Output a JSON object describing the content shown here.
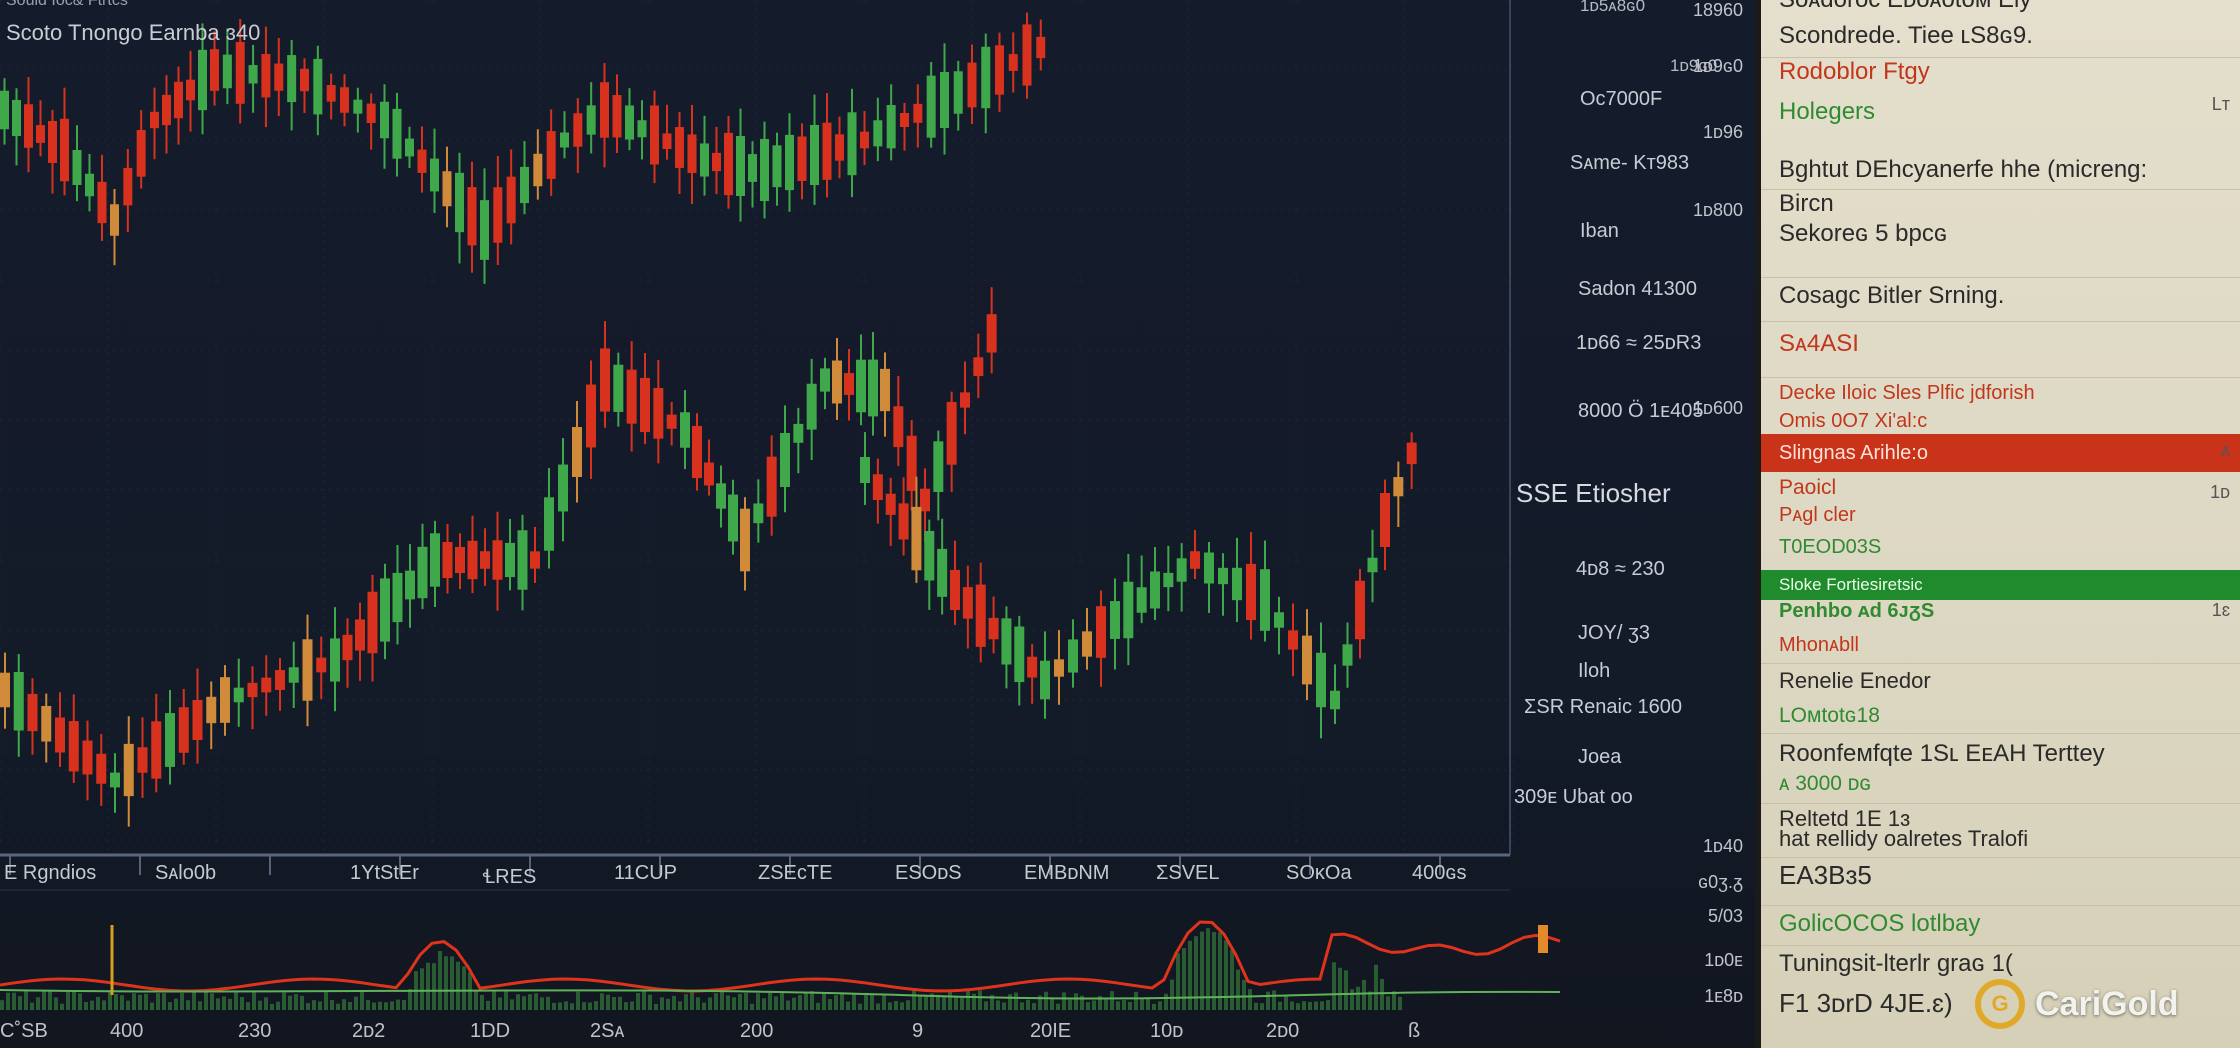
{
  "chart": {
    "top_label": "Sould Ioc& Ftrtcs",
    "title": "Scoto Tnongo Earnba ɜ40",
    "price_labels": [
      {
        "text": "1ᴅ5ᴀ8ɢ0",
        "size": "small"
      },
      {
        "text": "1ᴅ9ɢ0",
        "size": "small"
      },
      {
        "text": "Oc7000F",
        "size": "normal"
      },
      {
        "text": "Sᴀme- Kᴛ983",
        "size": "normal"
      },
      {
        "text": "Iban",
        "size": "normal"
      },
      {
        "text": "Sadon 41300",
        "size": "normal"
      },
      {
        "text": "1ᴅ66 ≈ 25ᴅR3",
        "size": "normal"
      },
      {
        "text": "8000 Ö 1ᴇ405",
        "size": "normal"
      },
      {
        "text": "SSE Etiosher",
        "size": "big"
      },
      {
        "text": "4ᴅ8 ≈ 230",
        "size": "normal"
      },
      {
        "text": "JOY/ ʒ3",
        "size": "normal"
      },
      {
        "text": "Iloh",
        "size": "normal"
      },
      {
        "text": "ƩSR Renaic 1600",
        "size": "normal"
      },
      {
        "text": "Joea",
        "size": "normal"
      },
      {
        "text": "309ᴇ Ubat oo",
        "size": "normal"
      }
    ],
    "right_prices": [
      "18960",
      "1ᴅ9ɢ0",
      "1ᴅ96",
      "1ᴅ800",
      "1ᴅ600",
      "1ᴅ40",
      "ɢ0ʒ.ᵹ",
      "5/03",
      "1ᴅ0ᴇ",
      "1ᴇ8ᴅ"
    ],
    "x_ticks": [
      "E Rgndios",
      "Sᴀlo0b",
      "1YtStEr",
      "ꞭRES",
      "11CUP",
      "ZSEᴄTE",
      "ESOᴅS",
      "EMBᴅNM",
      "ƩSVEL",
      "SOᴋOa",
      "400ɢs"
    ],
    "bottom_ticks": [
      "C˚SB",
      "400",
      "230",
      "2ᴅ2",
      "1DD",
      "2Sᴀ",
      "200",
      "9",
      "20IE",
      "10ᴅ",
      "2ᴅ0",
      "ß"
    ]
  },
  "sidebar": {
    "rows": [
      {
        "text": "Soᴀdoroc Eᴅoᴀotoᴍ Eiy",
        "style": "dark"
      },
      {
        "text": "Scondrede. Tiee ʟS8ɢ9.",
        "style": "dark"
      },
      {
        "text": "Rodoblor Ftgy",
        "style": "red"
      },
      {
        "text": "Holegers",
        "style": "green"
      },
      {
        "text": "Bghtut DEhcyanerfe hhe (micreng:",
        "style": "dark"
      },
      {
        "text": "Bircn",
        "style": "dark"
      },
      {
        "text": "Sekoreɢ 5 bpcɢ",
        "style": "dark"
      },
      {
        "text": "Cosagc Bitler Srning.",
        "style": "dark"
      },
      {
        "text": "Sᴀ4ASI",
        "style": "red"
      },
      {
        "text": "Decke Iloic Sles Plfic jdforish",
        "style": "red"
      },
      {
        "text": "Omis 0O7 Xiʹal:ᴄ",
        "style": "red"
      },
      {
        "text": "Slingnas Arihle:o",
        "style": "redbar"
      },
      {
        "text": "Paoicl",
        "style": "red"
      },
      {
        "text": "Pᴀgl cler",
        "style": "red"
      },
      {
        "text": "T0EOD03S",
        "style": "green"
      },
      {
        "text": "Sloke Fortiesiretsic",
        "style": "greenbar"
      },
      {
        "text": "Penhbo ᴀd 6ᴊᵹS",
        "style": "green"
      },
      {
        "text": "Mhonᴀbll",
        "style": "red"
      },
      {
        "text": "Renelie Enedor",
        "style": "dark"
      },
      {
        "text": "LOᴍtotɢ18",
        "style": "green"
      },
      {
        "text": "Roonfeᴍfqte 1Sʟ EᴇAH Terttey",
        "style": "dark"
      },
      {
        "text": "ᴀ 3000 ᴅɢ",
        "style": "green"
      },
      {
        "text": "Reltetd 1E 1ɜ",
        "style": "dark"
      },
      {
        "text": "hat ʀellidy oalretes Tralofi",
        "style": "dark"
      },
      {
        "text": "EA3Bɜ5",
        "style": "dark"
      },
      {
        "text": "GolicOCOS lotlbay",
        "style": "green"
      },
      {
        "text": "Tuningsit-lterlr graɢ 1(",
        "style": "dark"
      },
      {
        "text": "F1 3ᴅrD 4JE.ɛ)",
        "style": "dark"
      }
    ],
    "right_marks": [
      "Lᴛ",
      "ᴀ",
      "1ᴅ",
      "1ɛ"
    ]
  },
  "brand": {
    "name": "CariGold",
    "mark": "G",
    "accent": "#e0a92a"
  },
  "colors": {
    "up": "#3fa84a",
    "down": "#d8321e",
    "amber": "#cf8a3a",
    "volume_line": "#e0331c",
    "volume_bar": "#3a8a40"
  }
}
